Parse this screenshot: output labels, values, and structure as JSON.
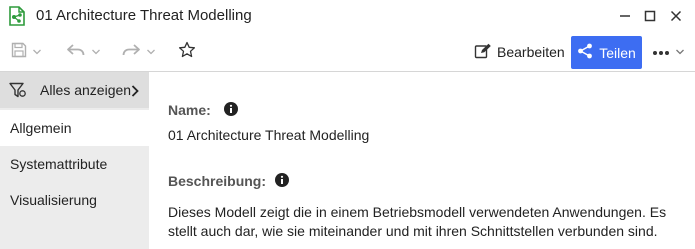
{
  "window": {
    "title": "01 Architecture Threat Modelling"
  },
  "toolbar": {
    "edit_label": "Bearbeiten",
    "share_label": "Teilen"
  },
  "sidebar": {
    "filter_label": "Alles anzeigen",
    "items": [
      {
        "label": "Allgemein",
        "active": true
      },
      {
        "label": "Systemattribute",
        "active": false
      },
      {
        "label": "Visualisierung",
        "active": false
      }
    ]
  },
  "main": {
    "name_label": "Name:",
    "name_value": "01 Architecture Threat Modelling",
    "description_label": "Beschreibung:",
    "description_value": "Dieses Modell zeigt die in einem Betriebsmodell verwendeten Anwendungen. Es stellt auch dar, wie sie miteinander und mit ihren Schnittstellen verbunden sind."
  },
  "colors": {
    "accent": "#3d6df2",
    "app_icon": "#2e9b3c",
    "sidebar_bg": "#ececec",
    "sidebar_active_bg": "#ffffff"
  }
}
